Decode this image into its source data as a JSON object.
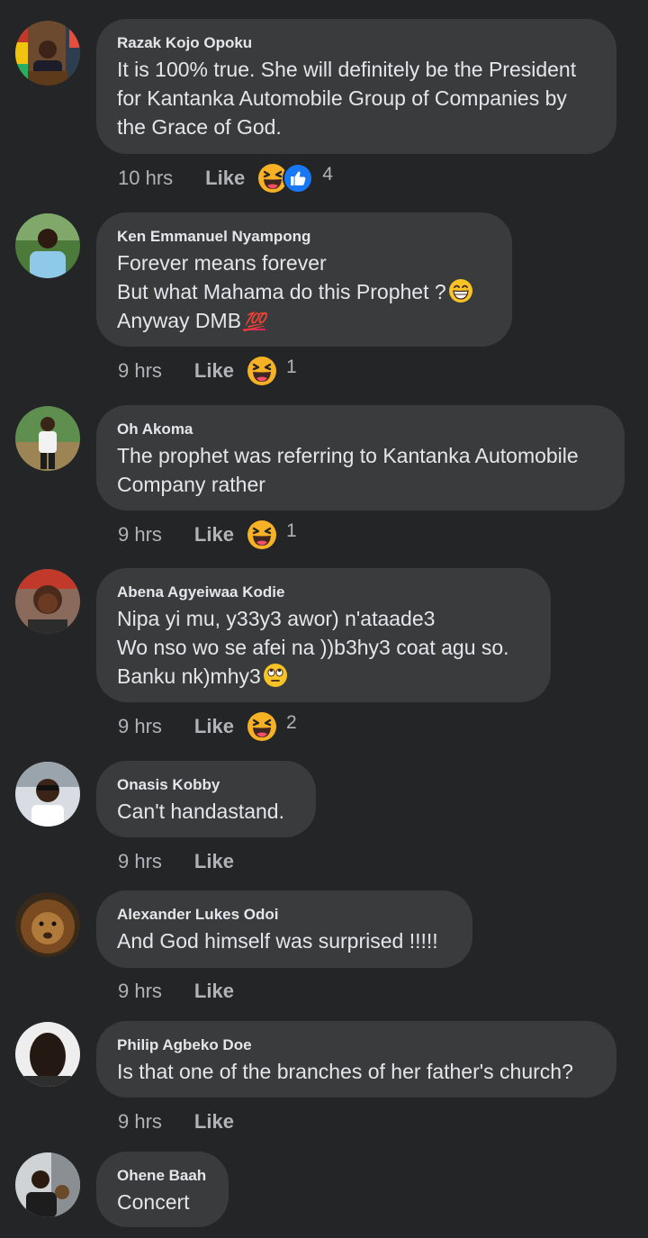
{
  "comments": [
    {
      "author": "Razak Kojo Opoku",
      "lines": [
        "It is 100% true. She will definitely be the President",
        "for Kantanka Automobile Group of Companies by",
        "the Grace of God."
      ],
      "time": "10 hrs",
      "like": "Like",
      "reactions": [
        "haha-icon",
        "like-icon"
      ],
      "count": "4"
    },
    {
      "author": "Ken Emmanuel Nyampong",
      "lines": [
        "Forever means forever",
        "But what Mahama do this Prophet ?",
        "Anyway DMB"
      ],
      "time": "9 hrs",
      "like": "Like",
      "reactions": [
        "haha-icon"
      ],
      "count": "1"
    },
    {
      "author": "Oh Akoma",
      "lines": [
        "The prophet was referring to Kantanka Automobile",
        "Company rather"
      ],
      "time": "9 hrs",
      "like": "Like",
      "reactions": [
        "haha-icon"
      ],
      "count": "1"
    },
    {
      "author": "Abena Agyeiwaa Kodie",
      "lines": [
        "Nipa yi mu, y33y3 awor) n'ataade3",
        "Wo nso wo se afei na ))b3hy3 coat agu so.",
        "Banku nk)mhy3"
      ],
      "time": "9 hrs",
      "like": "Like",
      "reactions": [
        "haha-icon"
      ],
      "count": "2"
    },
    {
      "author": "Onasis Kobby",
      "lines": [
        "Can't handastand."
      ],
      "time": "9 hrs",
      "like": "Like"
    },
    {
      "author": "Alexander Lukes Odoi",
      "lines": [
        "And God himself was surprised !!!!!"
      ],
      "time": "9 hrs",
      "like": "Like"
    },
    {
      "author": "Philip Agbeko Doe",
      "lines": [
        "Is that one of the branches of her father's church?"
      ],
      "time": "9 hrs",
      "like": "Like"
    },
    {
      "author": "Ohene Baah",
      "lines": [
        "Concert"
      ]
    }
  ],
  "inline_emoji": {
    "grin": "grinning-face-emoji",
    "hundred": "💯",
    "eyeroll": "face-with-rolling-eyes-emoji"
  },
  "colors": {
    "background": "#242526",
    "bubble": "#3a3b3c",
    "text": "#e4e6eb",
    "meta": "#b0b3b8",
    "like_blue": "#1877f2",
    "haha_yellow": "#f7b125"
  }
}
